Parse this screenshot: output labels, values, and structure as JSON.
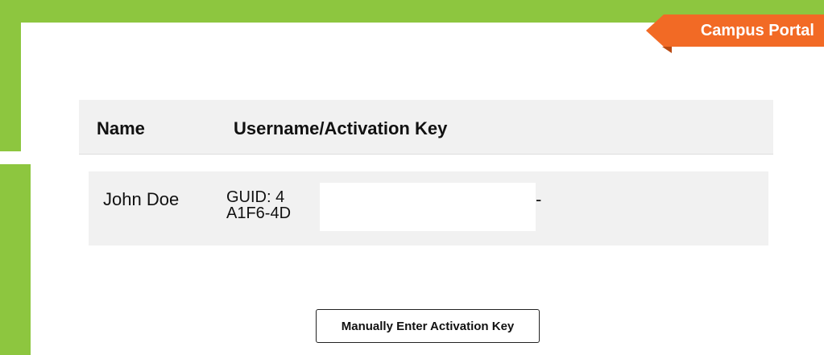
{
  "header": {
    "portal_tab": "Campus Portal"
  },
  "table": {
    "columns": [
      "Name",
      "Username/Activation Key"
    ],
    "rows": [
      {
        "name": "John Doe",
        "key_line1": "GUID: 4",
        "key_line2": "A1F6-4D",
        "key_suffix": "-"
      }
    ]
  },
  "actions": {
    "manual_entry_label": "Manually Enter Activation Key"
  },
  "colors": {
    "frame": "#8dc63f",
    "tab": "#f26a25",
    "row_bg": "#f1f1f1"
  }
}
